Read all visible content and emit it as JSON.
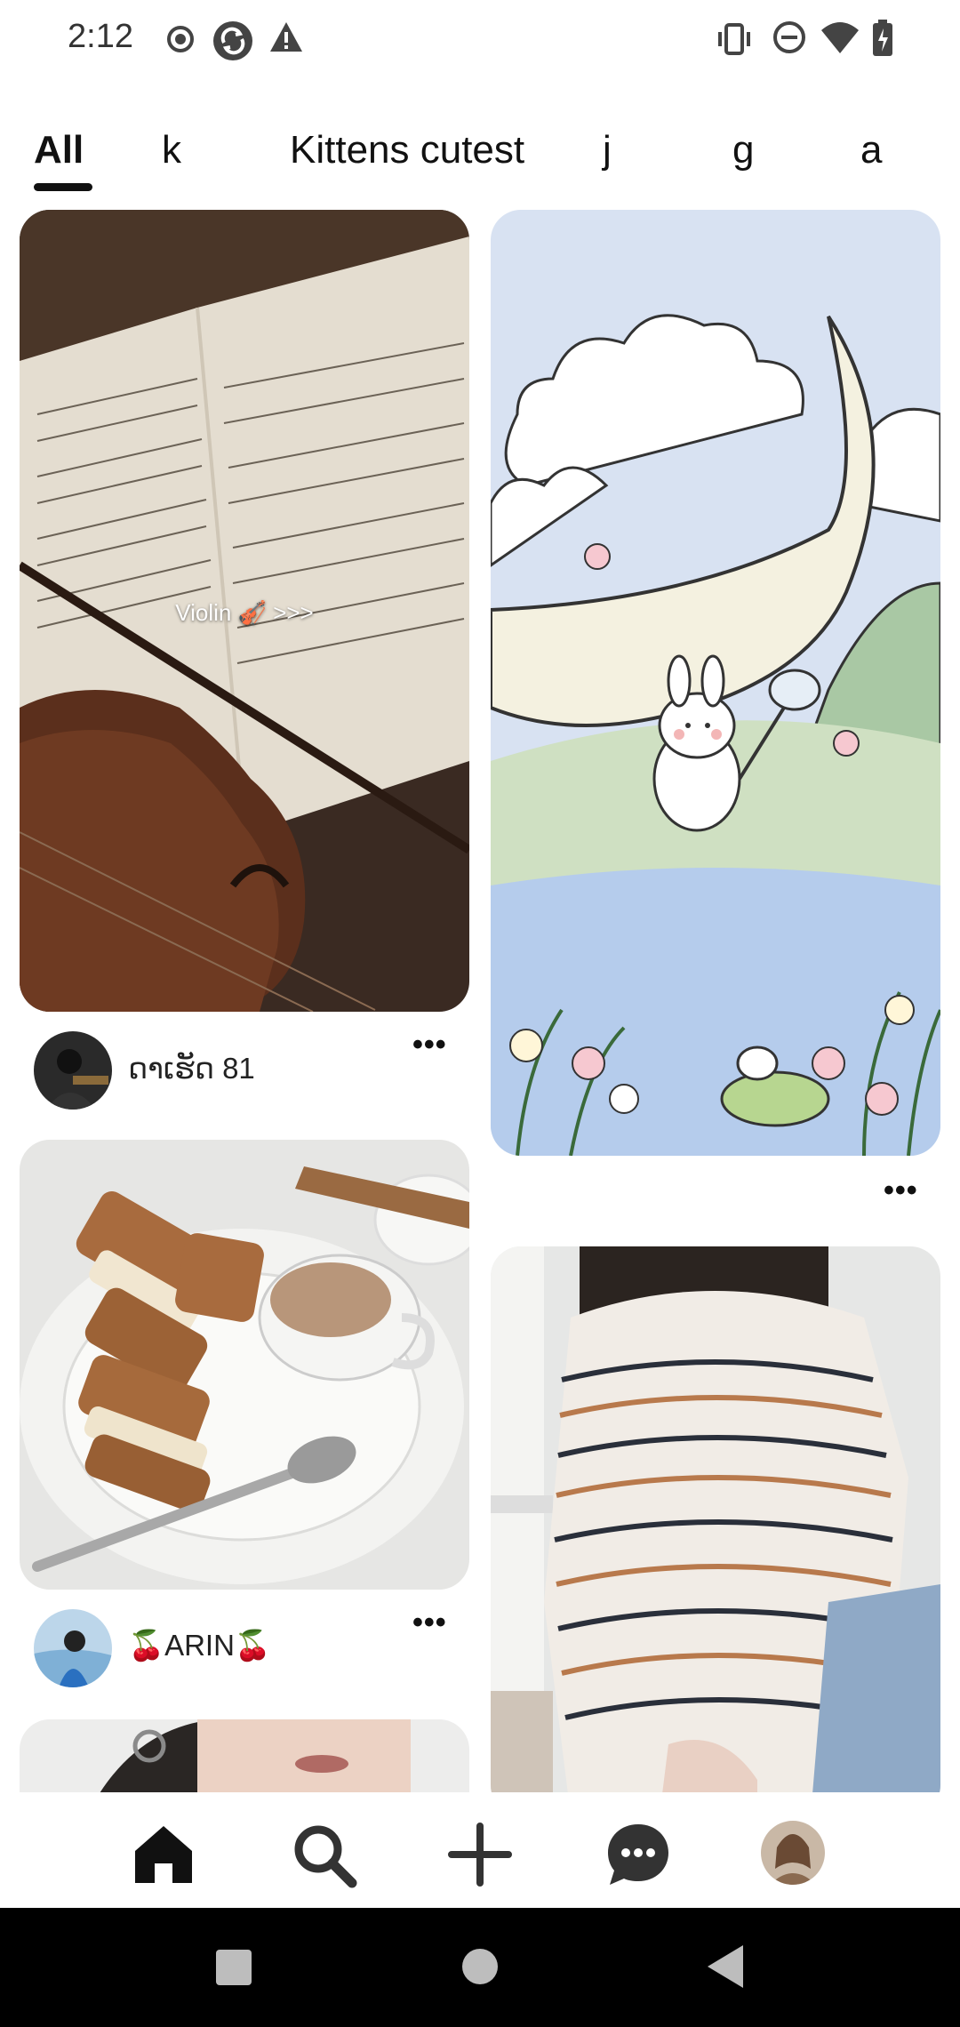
{
  "status": {
    "time": "2:12"
  },
  "tabs": [
    "All",
    "k",
    "Kittens cutest",
    "j",
    "g",
    "a"
  ],
  "pins": {
    "violin": {
      "overlay": "Violin 🎻 >>>",
      "author": "ດາເຮັດ 81"
    },
    "bunny": {},
    "cookies": {
      "author": "🍒ARIN🍒"
    },
    "sweater": {}
  },
  "nav": [
    "home-icon",
    "search-icon",
    "create-icon",
    "messages-icon",
    "profile-avatar"
  ],
  "colors": {
    "tab_underline": "#111111",
    "system_nav": "#000000"
  }
}
